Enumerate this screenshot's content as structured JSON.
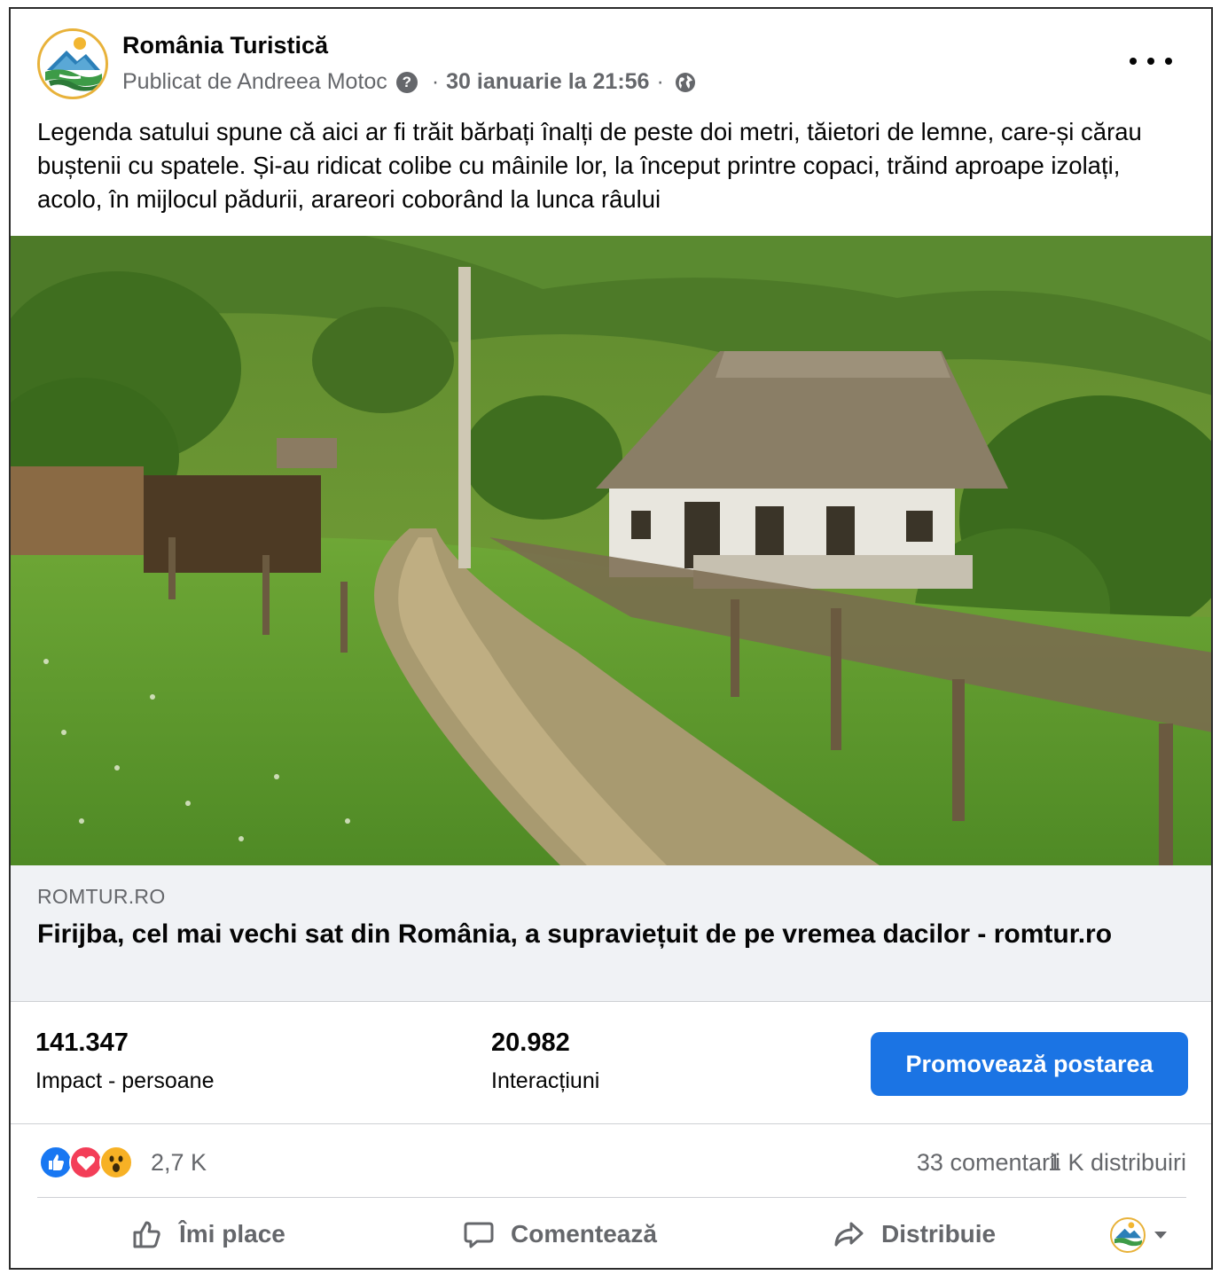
{
  "post": {
    "page_name": "România Turistică",
    "published_by": "Publicat de Andreea Motoc",
    "help_glyph": "?",
    "separator": "·",
    "date": "30 ianuarie la 21:56",
    "text": "Legenda satului spune că aici ar fi trăit bărbați înalți de peste doi metri, tăietori de lemne, care-și cărau buștenii cu spatele. Și-au ridicat colibe cu mâinile lor, la început printre copaci, trăind aproape izolați, acolo, în mijlocul pădurii, arareori coborând la lunca râului"
  },
  "link_preview": {
    "domain": "ROMTUR.RO",
    "title": "Firijba, cel mai vechi sat din România, a supraviețuit de pe vremea dacilor - romtur.ro"
  },
  "stats": {
    "reach_value": "141.347",
    "reach_label": "Impact - persoane",
    "engagement_value": "20.982",
    "engagement_label": "Interacțiuni",
    "promote_label": "Promovează postarea"
  },
  "reactions": {
    "count": "2,7 K",
    "comments": "33 comentarii",
    "shares": "1 K distribuiri",
    "types": [
      "like",
      "love",
      "wow"
    ]
  },
  "actions": {
    "like_label": "Îmi place",
    "comment_label": "Comentează",
    "share_label": "Distribuie"
  },
  "colors": {
    "accent": "#1b74e4",
    "secondary_text": "#65676b",
    "link_bg": "#f0f2f5",
    "like": "#1877f2",
    "love": "#f33e58",
    "wow": "#f7b125",
    "logo_ring": "#e8b23a"
  },
  "icons": {
    "more": "more-horizontal-icon",
    "privacy": "globe-icon",
    "like": "thumbs-up-icon",
    "comment": "comment-bubble-icon",
    "share": "share-arrow-icon",
    "dropdown": "caret-down-icon"
  }
}
